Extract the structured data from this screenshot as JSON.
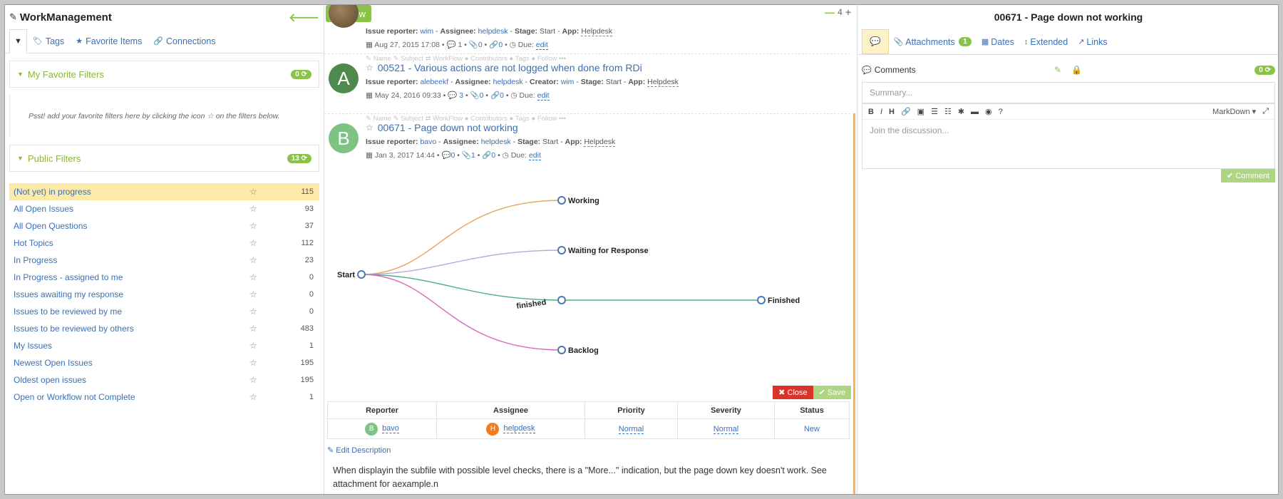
{
  "app": {
    "title": "WorkManagement"
  },
  "left_tabs": [
    {
      "label": ""
    },
    {
      "label": "Tags"
    },
    {
      "label": "Favorite Items"
    },
    {
      "label": "Connections"
    }
  ],
  "favorites": {
    "title": "My Favorite Filters",
    "count": "0",
    "hint": "Psst! add your favorite filters here by clicking the icon ☆ on the filters below."
  },
  "public": {
    "title": "Public Filters",
    "count": "13"
  },
  "filters": [
    {
      "name": "(Not yet) in progress",
      "count": "115"
    },
    {
      "name": "All Open Issues",
      "count": "93"
    },
    {
      "name": "All Open Questions",
      "count": "37"
    },
    {
      "name": "Hot Topics",
      "count": "112"
    },
    {
      "name": "In Progress",
      "count": "23"
    },
    {
      "name": "In Progress - assigned to me",
      "count": "0"
    },
    {
      "name": "Issues awaiting my response",
      "count": "0"
    },
    {
      "name": "Issues to be reviewed by me",
      "count": "0"
    },
    {
      "name": "Issues to be reviewed by others",
      "count": "483"
    },
    {
      "name": "My Issues",
      "count": "1"
    },
    {
      "name": "Newest Open Issues",
      "count": "195"
    },
    {
      "name": "Oldest open issues",
      "count": "195"
    },
    {
      "name": "Open or Workflow not Complete",
      "count": "1"
    }
  ],
  "toolbar": {
    "new_label": "New",
    "page_count": "4"
  },
  "issues": [
    {
      "reporter_label": "Issue reporter:",
      "reporter": "wim",
      "assignee_label": "Assignee:",
      "assignee": "helpdesk",
      "stage_label": "Stage:",
      "stage": "Start",
      "app_label": "App:",
      "app": "Helpdesk",
      "date": "Aug 27, 2015 17:08",
      "comments": "1",
      "attachments": "0",
      "links": "0",
      "due_label": "Due:",
      "due": "edit"
    },
    {
      "avatar": "A",
      "avatar_color": "#4e8a4e",
      "tools": "✎ Name  ✎ Subject  ⇄ WorkFlow  ● Contributors  ● Tags  ● Follow  •••",
      "title": "00521 - Various actions are not logged when done from RDi",
      "reporter_label": "Issue reporter:",
      "reporter": "alebeekf",
      "assignee_label": "Assignee:",
      "assignee": "helpdesk",
      "creator_label": "Creator:",
      "creator": "wim",
      "stage_label": "Stage:",
      "stage": "Start",
      "app_label": "App:",
      "app": "Helpdesk",
      "date": "May 24, 2016 09:33",
      "comments": "3",
      "attachments": "0",
      "links": "0",
      "due_label": "Due:",
      "due": "edit"
    },
    {
      "avatar": "B",
      "avatar_color": "#7dc383",
      "tools": "✎ Name  ✎ Subject  ⇄ WorkFlow  ● Contributors  ● Tags  ● Follow  •••",
      "title": "00671 - Page down not working",
      "reporter_label": "Issue reporter:",
      "reporter": "bavo",
      "assignee_label": "Assignee:",
      "assignee": "helpdesk",
      "stage_label": "Stage:",
      "stage": "Start",
      "app_label": "App:",
      "app": "Helpdesk",
      "date": "Jan 3, 2017 14:44",
      "comments": "0",
      "attachments": "1",
      "links": "0",
      "due_label": "Due:",
      "due": "edit"
    }
  ],
  "workflow": {
    "start": "Start",
    "nodes": [
      "Working",
      "Waiting for Response",
      "finished",
      "Finished",
      "Backlog"
    ],
    "colors": {
      "working": "#e8a35a",
      "waiting": "#b8a8d8",
      "finished": "#4caf82",
      "backlog": "#d96ab8"
    }
  },
  "actions": {
    "close": "Close",
    "save": "Save"
  },
  "props": {
    "headers": [
      "Reporter",
      "Assignee",
      "Priority",
      "Severity",
      "Status"
    ],
    "reporter": "bavo",
    "reporter_initial": "B",
    "assignee": "helpdesk",
    "assignee_initial": "H",
    "priority": "Normal",
    "severity": "Normal",
    "status": "New"
  },
  "description": {
    "edit_label": "Edit Description",
    "text": "When displayin the subfile with possible level checks, there is a \"More...\" indication, but the page down key doesn't work. See attachment for aexample.n"
  },
  "detail": {
    "title": "00671 - Page down not working",
    "tabs": [
      {
        "label": ""
      },
      {
        "label": "Attachments",
        "badge": "1"
      },
      {
        "label": "Dates"
      },
      {
        "label": "Extended"
      },
      {
        "label": "Links"
      }
    ],
    "comments_label": "Comments",
    "comments_count": "0",
    "summary_placeholder": "Summary...",
    "editor_mode": "MarkDown",
    "discussion_placeholder": "Join the discussion...",
    "comment_button": "Comment"
  }
}
